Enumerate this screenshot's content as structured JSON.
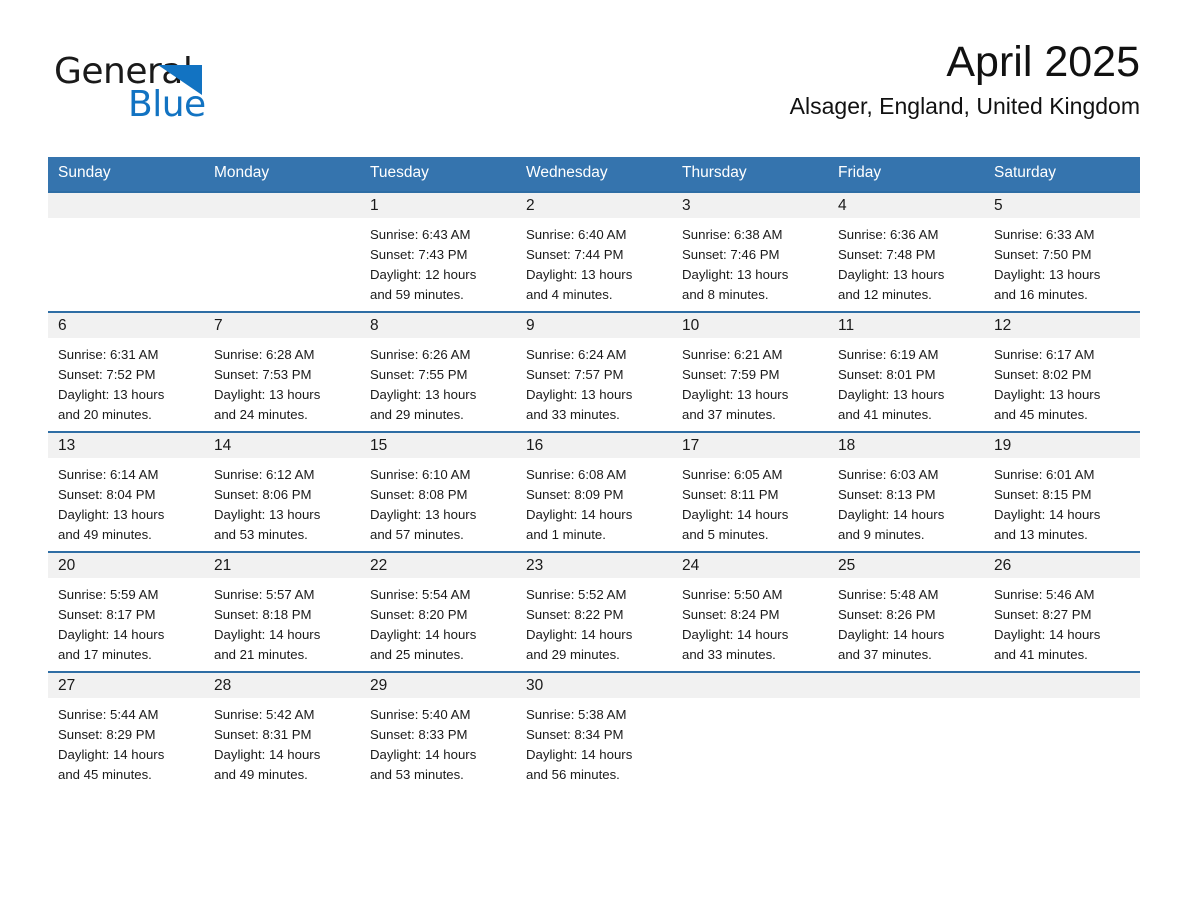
{
  "brand": {
    "name_part1": "General",
    "name_part2": "Blue",
    "accent_color": "#1273c2",
    "logo_icon": "triangle-icon"
  },
  "header": {
    "month_title": "April 2025",
    "location": "Alsager, England, United Kingdom"
  },
  "calendar": {
    "header_color": "#3574ae",
    "row_border_color": "#2e6da4",
    "daynum_background": "#f1f1f1",
    "weekday_headers": [
      "Sunday",
      "Monday",
      "Tuesday",
      "Wednesday",
      "Thursday",
      "Friday",
      "Saturday"
    ],
    "weeks": [
      [
        {
          "day": "",
          "text": ""
        },
        {
          "day": "",
          "text": ""
        },
        {
          "day": "1",
          "text": "Sunrise: 6:43 AM\nSunset: 7:43 PM\nDaylight: 12 hours\nand 59 minutes."
        },
        {
          "day": "2",
          "text": "Sunrise: 6:40 AM\nSunset: 7:44 PM\nDaylight: 13 hours\nand 4 minutes."
        },
        {
          "day": "3",
          "text": "Sunrise: 6:38 AM\nSunset: 7:46 PM\nDaylight: 13 hours\nand 8 minutes."
        },
        {
          "day": "4",
          "text": "Sunrise: 6:36 AM\nSunset: 7:48 PM\nDaylight: 13 hours\nand 12 minutes."
        },
        {
          "day": "5",
          "text": "Sunrise: 6:33 AM\nSunset: 7:50 PM\nDaylight: 13 hours\nand 16 minutes."
        }
      ],
      [
        {
          "day": "6",
          "text": "Sunrise: 6:31 AM\nSunset: 7:52 PM\nDaylight: 13 hours\nand 20 minutes."
        },
        {
          "day": "7",
          "text": "Sunrise: 6:28 AM\nSunset: 7:53 PM\nDaylight: 13 hours\nand 24 minutes."
        },
        {
          "day": "8",
          "text": "Sunrise: 6:26 AM\nSunset: 7:55 PM\nDaylight: 13 hours\nand 29 minutes."
        },
        {
          "day": "9",
          "text": "Sunrise: 6:24 AM\nSunset: 7:57 PM\nDaylight: 13 hours\nand 33 minutes."
        },
        {
          "day": "10",
          "text": "Sunrise: 6:21 AM\nSunset: 7:59 PM\nDaylight: 13 hours\nand 37 minutes."
        },
        {
          "day": "11",
          "text": "Sunrise: 6:19 AM\nSunset: 8:01 PM\nDaylight: 13 hours\nand 41 minutes."
        },
        {
          "day": "12",
          "text": "Sunrise: 6:17 AM\nSunset: 8:02 PM\nDaylight: 13 hours\nand 45 minutes."
        }
      ],
      [
        {
          "day": "13",
          "text": "Sunrise: 6:14 AM\nSunset: 8:04 PM\nDaylight: 13 hours\nand 49 minutes."
        },
        {
          "day": "14",
          "text": "Sunrise: 6:12 AM\nSunset: 8:06 PM\nDaylight: 13 hours\nand 53 minutes."
        },
        {
          "day": "15",
          "text": "Sunrise: 6:10 AM\nSunset: 8:08 PM\nDaylight: 13 hours\nand 57 minutes."
        },
        {
          "day": "16",
          "text": "Sunrise: 6:08 AM\nSunset: 8:09 PM\nDaylight: 14 hours\nand 1 minute."
        },
        {
          "day": "17",
          "text": "Sunrise: 6:05 AM\nSunset: 8:11 PM\nDaylight: 14 hours\nand 5 minutes."
        },
        {
          "day": "18",
          "text": "Sunrise: 6:03 AM\nSunset: 8:13 PM\nDaylight: 14 hours\nand 9 minutes."
        },
        {
          "day": "19",
          "text": "Sunrise: 6:01 AM\nSunset: 8:15 PM\nDaylight: 14 hours\nand 13 minutes."
        }
      ],
      [
        {
          "day": "20",
          "text": "Sunrise: 5:59 AM\nSunset: 8:17 PM\nDaylight: 14 hours\nand 17 minutes."
        },
        {
          "day": "21",
          "text": "Sunrise: 5:57 AM\nSunset: 8:18 PM\nDaylight: 14 hours\nand 21 minutes."
        },
        {
          "day": "22",
          "text": "Sunrise: 5:54 AM\nSunset: 8:20 PM\nDaylight: 14 hours\nand 25 minutes."
        },
        {
          "day": "23",
          "text": "Sunrise: 5:52 AM\nSunset: 8:22 PM\nDaylight: 14 hours\nand 29 minutes."
        },
        {
          "day": "24",
          "text": "Sunrise: 5:50 AM\nSunset: 8:24 PM\nDaylight: 14 hours\nand 33 minutes."
        },
        {
          "day": "25",
          "text": "Sunrise: 5:48 AM\nSunset: 8:26 PM\nDaylight: 14 hours\nand 37 minutes."
        },
        {
          "day": "26",
          "text": "Sunrise: 5:46 AM\nSunset: 8:27 PM\nDaylight: 14 hours\nand 41 minutes."
        }
      ],
      [
        {
          "day": "27",
          "text": "Sunrise: 5:44 AM\nSunset: 8:29 PM\nDaylight: 14 hours\nand 45 minutes."
        },
        {
          "day": "28",
          "text": "Sunrise: 5:42 AM\nSunset: 8:31 PM\nDaylight: 14 hours\nand 49 minutes."
        },
        {
          "day": "29",
          "text": "Sunrise: 5:40 AM\nSunset: 8:33 PM\nDaylight: 14 hours\nand 53 minutes."
        },
        {
          "day": "30",
          "text": "Sunrise: 5:38 AM\nSunset: 8:34 PM\nDaylight: 14 hours\nand 56 minutes."
        },
        {
          "day": "",
          "text": ""
        },
        {
          "day": "",
          "text": ""
        },
        {
          "day": "",
          "text": ""
        }
      ]
    ]
  }
}
